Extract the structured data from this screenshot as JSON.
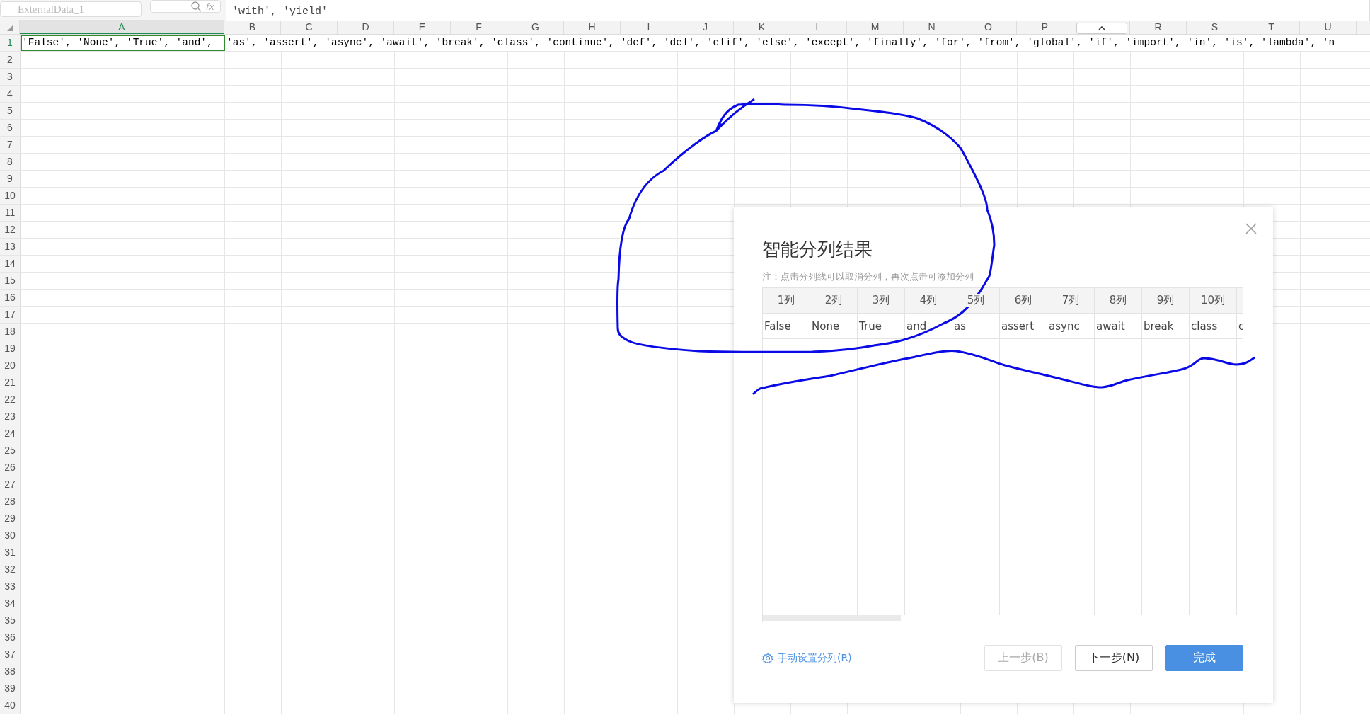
{
  "name_box": {
    "value": "ExternalData_1"
  },
  "formula_bar": {
    "fx": "fx",
    "value": "'with', 'yield'"
  },
  "columns": [
    {
      "label": "A",
      "selected": true
    },
    {
      "label": "B",
      "selected": false
    },
    {
      "label": "C",
      "selected": false
    },
    {
      "label": "D",
      "selected": false
    },
    {
      "label": "E",
      "selected": false
    },
    {
      "label": "F",
      "selected": false
    },
    {
      "label": "G",
      "selected": false
    },
    {
      "label": "H",
      "selected": false
    },
    {
      "label": "I",
      "selected": false
    },
    {
      "label": "J",
      "selected": false
    },
    {
      "label": "K",
      "selected": false
    },
    {
      "label": "L",
      "selected": false
    },
    {
      "label": "M",
      "selected": false
    },
    {
      "label": "N",
      "selected": false
    },
    {
      "label": "O",
      "selected": false
    },
    {
      "label": "P",
      "selected": false
    },
    {
      "kind": "collapse"
    },
    {
      "label": "R",
      "selected": false
    },
    {
      "label": "S",
      "selected": false
    },
    {
      "label": "T",
      "selected": false
    },
    {
      "label": "U",
      "selected": false
    }
  ],
  "rows": [
    "1",
    "2",
    "3",
    "4",
    "5",
    "6",
    "7",
    "8",
    "9",
    "10",
    "11",
    "12",
    "13",
    "14",
    "15",
    "16",
    "17",
    "18",
    "19",
    "20",
    "21",
    "22",
    "23",
    "24",
    "25",
    "26",
    "27",
    "28",
    "29",
    "30",
    "31",
    "32",
    "33",
    "34",
    "35",
    "36",
    "37",
    "38",
    "39",
    "40"
  ],
  "row1": {
    "cell_a": "'False', 'None', 'True', 'and',",
    "overflow": "'as', 'assert', 'async', 'await', 'break', 'class', 'continue', 'def', 'del', 'elif', 'else', 'except', 'finally', 'for', 'from', 'global', 'if', 'import', 'in', 'is', 'lambda', 'n"
  },
  "dialog": {
    "title": "智能分列结果",
    "note": "注：点击分列线可以取消分列，再次点击可添加分列",
    "columns": [
      {
        "header": "1列",
        "value": "False"
      },
      {
        "header": "2列",
        "value": "None"
      },
      {
        "header": "3列",
        "value": "True"
      },
      {
        "header": "4列",
        "value": "and"
      },
      {
        "header": "5列",
        "value": "as"
      },
      {
        "header": "6列",
        "value": "assert"
      },
      {
        "header": "7列",
        "value": "async"
      },
      {
        "header": "8列",
        "value": "await"
      },
      {
        "header": "9列",
        "value": "break"
      },
      {
        "header": "10列",
        "value": "class"
      },
      {
        "value": "c"
      }
    ],
    "manual_link": "手动设置分列(R)",
    "buttons": [
      {
        "label": "上一步(B)",
        "kind": "secondary",
        "disabled": true
      },
      {
        "label": "下一步(N)",
        "kind": "secondary",
        "disabled": false
      },
      {
        "label": "完成",
        "kind": "primary",
        "disabled": false
      }
    ]
  }
}
